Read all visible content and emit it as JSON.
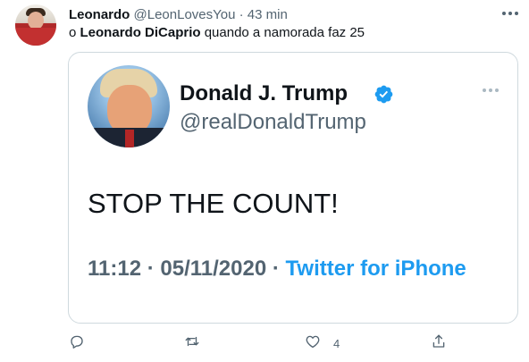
{
  "tweet": {
    "author_name": "Leonardo",
    "author_handle": "@LeonLovesYou",
    "separator": "·",
    "time": "43 min",
    "text_prefix": "o",
    "text_mention": "Leonardo DiCaprio",
    "text_suffix": "quando a namorada faz 25"
  },
  "quoted": {
    "name": "Donald J. Trump",
    "handle": "@realDonaldTrump",
    "body": "STOP THE COUNT!",
    "time": "11:12",
    "separator": "·",
    "date": "05/11/2020",
    "separator2": "·",
    "source": "Twitter for iPhone"
  },
  "actions": {
    "reply_count": "",
    "retweet_count": "",
    "like_count": "4",
    "share_count": ""
  },
  "icons": {
    "verified": "verified-badge-icon",
    "reply": "reply-icon",
    "retweet": "retweet-icon",
    "like": "heart-icon",
    "share": "share-icon",
    "more": "more-icon"
  },
  "colors": {
    "accent": "#1d9bf0",
    "secondary_text": "#536471",
    "border": "#cfd9de"
  }
}
